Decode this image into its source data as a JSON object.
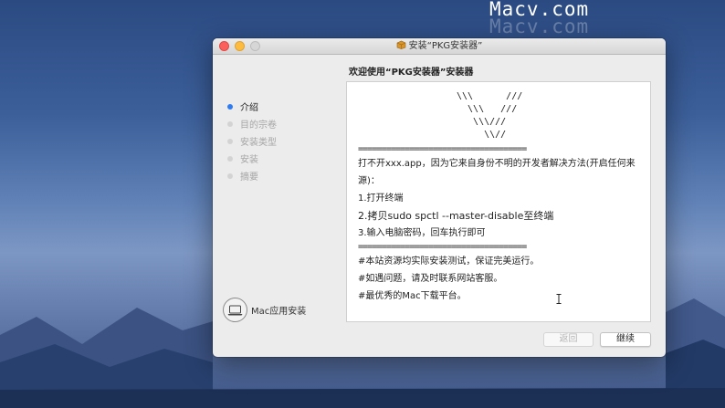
{
  "watermark": {
    "primary": "Macv.com",
    "shadow": "Macv.com"
  },
  "window": {
    "title": "安装“PKG安装器”",
    "header": "欢迎使用“PKG安装器”安装器"
  },
  "sidebar": {
    "steps": [
      {
        "label": "介绍",
        "active": true
      },
      {
        "label": "目的宗卷",
        "active": false
      },
      {
        "label": "安装类型",
        "active": false
      },
      {
        "label": "安装",
        "active": false
      },
      {
        "label": "摘要",
        "active": false
      }
    ],
    "brand_label": "Mac应用安装"
  },
  "content": {
    "ascii_art": "\\\\\\      ///\n  \\\\\\   ///\n   \\\\\\///\n     \\\\//",
    "separator_top": "====================================",
    "lines": [
      "打不开xxx.app，因为它来自身份不明的开发者解决方法(开启任何来源)：",
      "1.打开终端",
      "2.拷贝sudo spctl --master-disable至终端",
      "3.输入电脑密码，回车执行即可"
    ],
    "separator_bottom": "====================================",
    "notes": [
      "#本站资源均实际安装测试，保证完美运行。",
      "#如遇问题，请及时联系网站客服。",
      "#最优秀的Mac下载平台。"
    ]
  },
  "buttons": {
    "back": "返回",
    "continue": "继续"
  },
  "colors": {
    "accent": "#2f7bf2",
    "close": "#fc605c",
    "minimize": "#fdbc40"
  }
}
